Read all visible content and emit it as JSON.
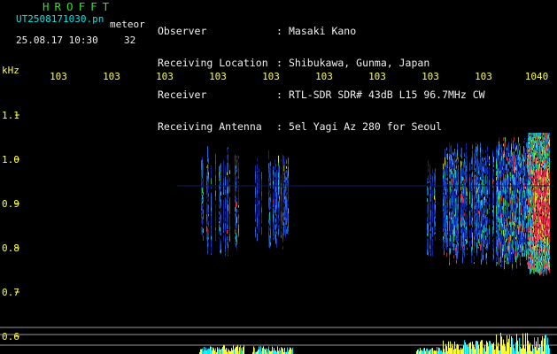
{
  "header": {
    "title": "HROFFT",
    "filename": "UT2508171030.pn",
    "event_label": "meteor",
    "datetime": "25.08.17 10:30",
    "count": "32",
    "info_labels": [
      "Observer",
      "Receiving Location",
      "Receiver",
      "Receiving Antenna"
    ],
    "info_colon": ":",
    "info_values": [
      "Masaki Kano",
      "Shibukawa, Gunma, Japan",
      "RTL-SDR SDR# 43dB L15 96.7MHz CW",
      "5el Yagi Az 280 for Seoul"
    ]
  },
  "axis": {
    "y_unit": "kHz",
    "y_ticks": [
      "1.1",
      "1.0",
      "0.9",
      "0.8",
      "0.7",
      "0.6"
    ],
    "x_ticks": [
      "103",
      "103",
      "103",
      "103",
      "103",
      "103",
      "103",
      "103",
      "103",
      "1040"
    ]
  },
  "colors": {
    "background": "#000000",
    "title": "#33dd33",
    "filename": "#00e5e5",
    "header_text": "#f0f0f0",
    "axis_text": "#ffff33",
    "grid": "#9a9a9a",
    "bottom_bars": "#ffff33"
  }
}
